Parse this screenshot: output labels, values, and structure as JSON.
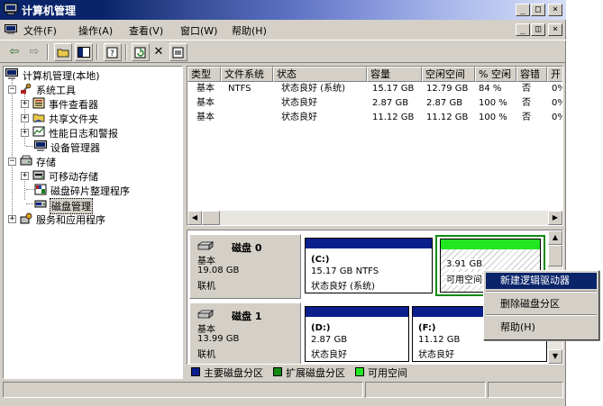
{
  "window": {
    "title": "计算机管理"
  },
  "menu": [
    "文件(F)",
    "操作(A)",
    "查看(V)",
    "窗口(W)",
    "帮助(H)"
  ],
  "tree": {
    "root": "计算机管理(本地)",
    "system_tools": "系统工具",
    "event_viewer": "事件查看器",
    "shared_folders": "共享文件夹",
    "perf_logs": "性能日志和警报",
    "device_manager": "设备管理器",
    "storage": "存储",
    "removable": "可移动存储",
    "defrag": "磁盘碎片整理程序",
    "disk_mgmt": "磁盘管理",
    "services": "服务和应用程序"
  },
  "volumes": {
    "columns": [
      "类型",
      "文件系统",
      "状态",
      "容量",
      "空闲空间",
      "% 空闲",
      "容错",
      "开"
    ],
    "rows": [
      [
        "基本",
        "NTFS",
        "状态良好 (系统)",
        "15.17 GB",
        "12.79 GB",
        "84 %",
        "否",
        "0%"
      ],
      [
        "基本",
        "",
        "状态良好",
        "2.87 GB",
        "2.87 GB",
        "100 %",
        "否",
        "0%"
      ],
      [
        "基本",
        "",
        "状态良好",
        "11.12 GB",
        "11.12 GB",
        "100 %",
        "否",
        "0%"
      ]
    ]
  },
  "disks": [
    {
      "name": "磁盘 0",
      "type": "基本",
      "size": "19.08 GB",
      "status": "联机",
      "partitions": [
        {
          "label": "(C:)",
          "detail": "15.17 GB NTFS",
          "status": "状态良好 (系统)"
        },
        {
          "label": "",
          "detail": "3.91 GB",
          "status": "可用空间"
        }
      ]
    },
    {
      "name": "磁盘 1",
      "type": "基本",
      "size": "13.99 GB",
      "status": "联机",
      "partitions": [
        {
          "label": "(D:)",
          "detail": "2.87 GB",
          "status": "状态良好"
        },
        {
          "label": "(F:)",
          "detail": "11.12 GB",
          "status": "状态良好"
        }
      ]
    }
  ],
  "legend": [
    "主要磁盘分区",
    "扩展磁盘分区",
    "可用空间"
  ],
  "context_menu": [
    "新建逻辑驱动器",
    "删除磁盘分区",
    "帮助(H)"
  ],
  "colors": {
    "primary": "#0a1f8c",
    "extended": "#128a12",
    "free": "#22e622",
    "highlight": "#0a246a"
  }
}
